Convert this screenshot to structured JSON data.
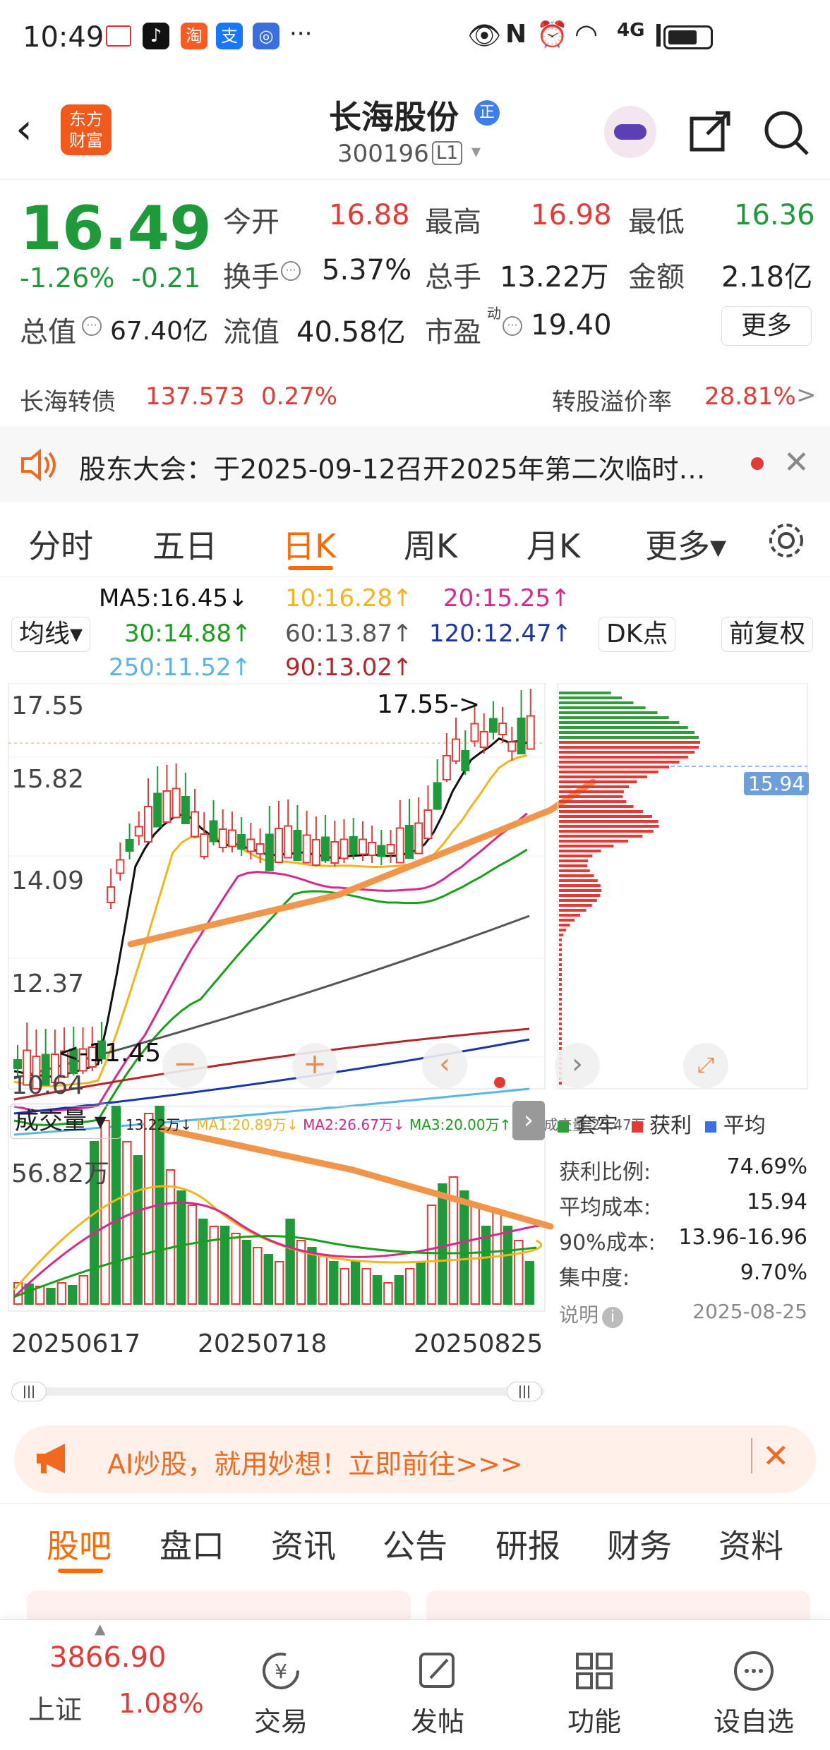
{
  "status_bar": {
    "time": "10:49",
    "network": "4G"
  },
  "header": {
    "title": "长海股份",
    "code": "300196",
    "level": "L1",
    "logo": "东方\n财富",
    "zheng_badge": "正"
  },
  "quote": {
    "price": "16.49",
    "change_pct": "-1.26%",
    "change": "-0.21",
    "open_label": "今开",
    "open": "16.88",
    "high_label": "最高",
    "high": "16.98",
    "low_label": "最低",
    "low": "16.36",
    "turnover_label": "换手",
    "turnover": "5.37%",
    "volume_label": "总手",
    "volume": "13.22万",
    "amount_label": "金额",
    "amount": "2.18亿",
    "mktcap_label": "总值",
    "mktcap": "67.40亿",
    "float_label": "流值",
    "float": "40.58亿",
    "pe_label": "市盈",
    "pe_sup": "动",
    "pe": "19.40",
    "more": "更多",
    "bond_label": "长海转债",
    "bond_price": "137.573",
    "bond_pct": "0.27%",
    "premium_label": "转股溢价率",
    "premium": "28.81%",
    "premium_arrow": ">"
  },
  "notice": {
    "text": "股东大会：于2025-09-12召开2025年第二次临时…"
  },
  "tabs": [
    {
      "label": "分时"
    },
    {
      "label": "五日"
    },
    {
      "label": "日K"
    },
    {
      "label": "周K"
    },
    {
      "label": "月K"
    },
    {
      "label": "更多▾"
    }
  ],
  "ma": {
    "ma5": "MA5:16.45↓",
    "ma10": "10:16.28↑",
    "ma20": "20:15.25↑",
    "ma30": "30:14.88↑",
    "ma60": "60:13.87↑",
    "ma120": "120:12.47↑",
    "ma250": "250:11.52↑",
    "ma90": "90:13.02↑"
  },
  "controls": {
    "junxian": "均线▾",
    "dk": "DK点",
    "fq": "前复权"
  },
  "price_axis": {
    "p1": "17.55",
    "p2": "15.82",
    "p3": "14.09",
    "p4": "12.37",
    "p5": "10.64"
  },
  "annotations": {
    "high_mark": "17.55->",
    "low_mark": "<-11.45",
    "cost_line": "15.94"
  },
  "volume": {
    "label": "成交量",
    "info": "13.22万↓",
    "ma1": "MA1:20.89万↓",
    "ma2": "MA2:26.67万↓",
    "ma3": "MA3:20.00万↑",
    "virtual": "虚拟成交量:25.47万",
    "max": "56.82万"
  },
  "dates": {
    "d1": "20250617",
    "d2": "20250718",
    "d3": "20250825"
  },
  "chip": {
    "legend_trap": "套牢",
    "legend_profit": "获利",
    "legend_avg": "平均",
    "rows": [
      {
        "label": "获利比例:",
        "value": "74.69%"
      },
      {
        "label": "平均成本:",
        "value": "15.94"
      },
      {
        "label": "90%成本:",
        "value": "13.96-16.96"
      },
      {
        "label": "集中度:",
        "value": "9.70%"
      }
    ],
    "note_label": "说明",
    "date": "2025-08-25"
  },
  "ai_banner": {
    "text": "AI炒股，就用妙想！立即前往>>>"
  },
  "section_tabs": [
    {
      "label": "股吧"
    },
    {
      "label": "盘口"
    },
    {
      "label": "资讯"
    },
    {
      "label": "公告"
    },
    {
      "label": "研报"
    },
    {
      "label": "财务"
    },
    {
      "label": "资料"
    }
  ],
  "bottom": {
    "index_value": "3866.90",
    "index_name": "上证",
    "index_pct": "1.08%",
    "trade": "交易",
    "post": "发帖",
    "func": "功能",
    "watch": "设自选"
  },
  "colors": {
    "red": "#e53935",
    "green": "#1e9a3a",
    "orange": "#ff6a00",
    "ma5": "#111111",
    "ma10": "#f2b51a",
    "ma20": "#d42a8c",
    "ma30": "#18a018",
    "ma60": "#555555",
    "ma120": "#1a35a8",
    "ma250": "#5ab4e6",
    "ma90": "#b3262a"
  }
}
